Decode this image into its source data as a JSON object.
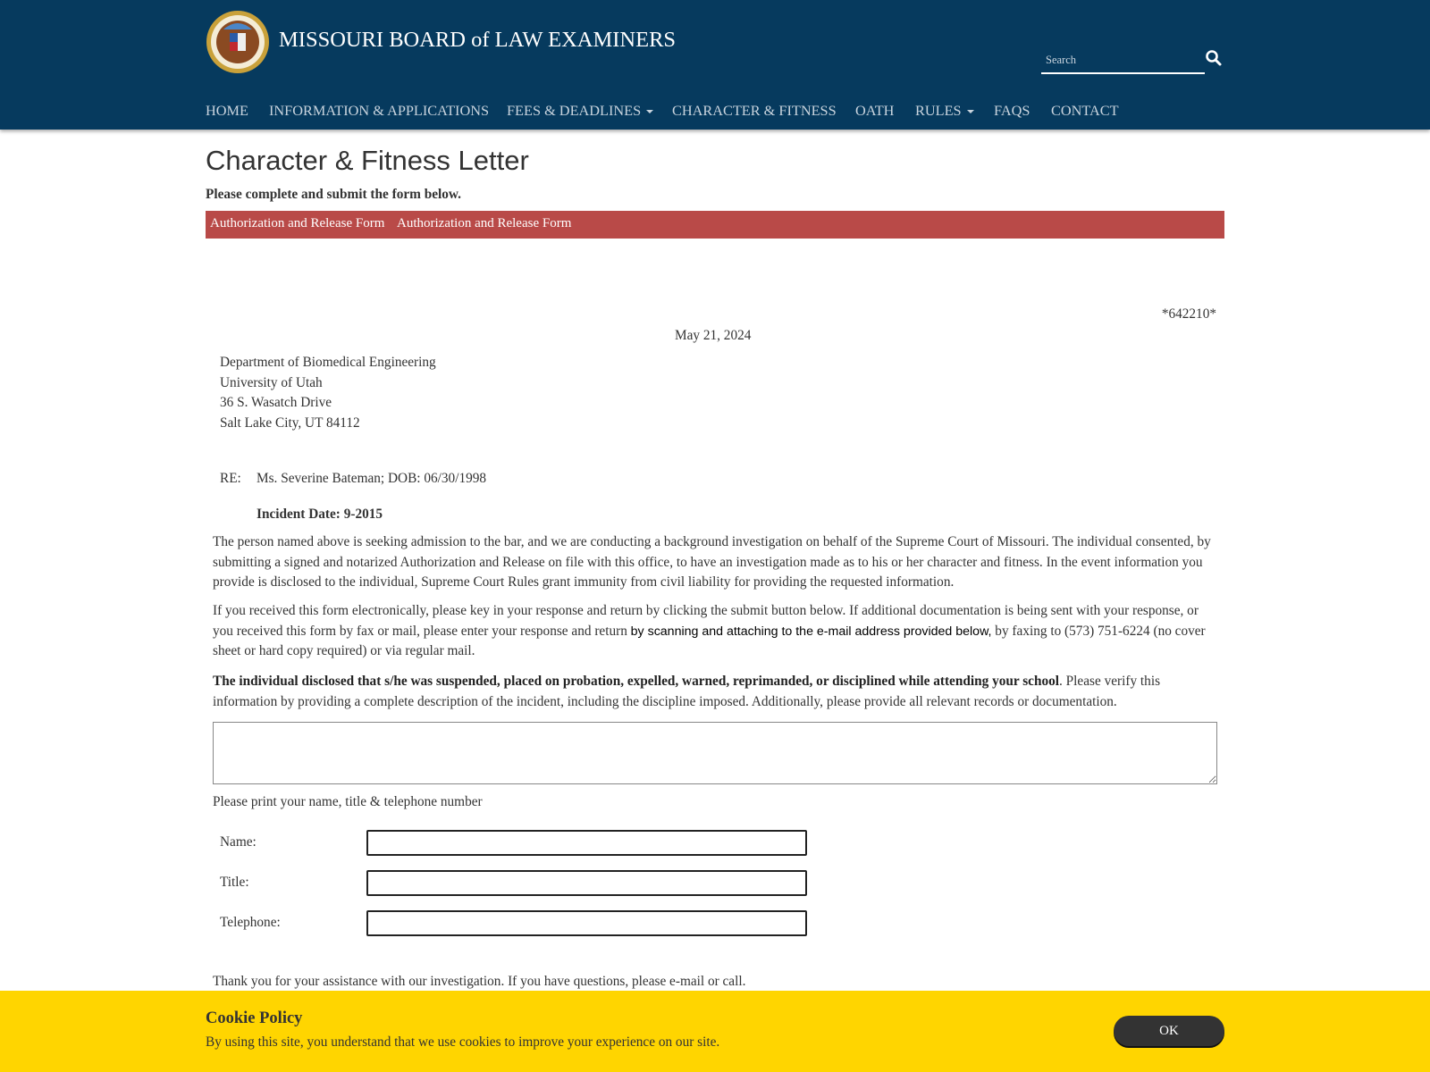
{
  "header": {
    "title": "MISSOURI BOARD of LAW EXAMINERS",
    "search_placeholder": "Search",
    "nav": [
      {
        "label": "HOME"
      },
      {
        "label": "INFORMATION & APPLICATIONS"
      },
      {
        "label": "FEES & DEADLINES",
        "dropdown": true
      },
      {
        "label": "CHARACTER & FITNESS"
      },
      {
        "label": "OATH"
      },
      {
        "label": "RULES",
        "dropdown": true
      },
      {
        "label": "FAQS"
      },
      {
        "label": "CONTACT"
      }
    ]
  },
  "page": {
    "title": "Character & Fitness Letter",
    "subtitle": "Please complete and submit the form below.",
    "tabs": [
      "Authorization and Release Form",
      "Authorization and Release Form"
    ],
    "tab_bar_color": "#b94a48"
  },
  "letter": {
    "code": "*642210*",
    "date": "May 21, 2024",
    "address": [
      "Department of Biomedical Engineering",
      "University of Utah",
      "36 S. Wasatch Drive",
      "Salt Lake City, UT 84112"
    ],
    "re_label": "RE:",
    "re_value": "Ms. Severine Bateman; DOB: 06/30/1998",
    "incident": "Incident Date: 9-2015",
    "para1": "The person named above is seeking admission to the bar, and we are conducting a background investigation on behalf of the Supreme Court of Missouri. The individual consented, by submitting a signed and notarized Authorization and Release on file with this office, to have an investigation made as to his or her character and fitness. In the event information you provide is disclosed to the individual, Supreme Court Rules grant immunity from civil liability for providing the requested information.",
    "para2a": "If you received this form electronically, please key in your response and return by clicking the submit button below. If additional documentation is being sent with your response, or you received this form by fax or mail, please enter your response and return ",
    "para2b": "by scanning and attaching to the e-mail address provided below,",
    "para2c": " by faxing to (573) 751-6224 (no cover sheet or hard copy required) or via regular mail.",
    "para3_bold": "The individual disclosed that s/he was suspended, placed on probation, expelled, warned, reprimanded, or disciplined while attending your school",
    "para3_rest": ". Please verify this information by providing a complete description of the incident, including the discipline imposed. Additionally, please provide all relevant records or documentation.",
    "response_value": "",
    "print_prompt": "Please print your name, title & telephone number",
    "fields": [
      {
        "label": "Name:",
        "value": ""
      },
      {
        "label": "Title:",
        "value": ""
      },
      {
        "label": "Telephone:",
        "value": ""
      }
    ],
    "thanks": "Thank you for your assistance with our investigation. If you have questions, please e-mail or call."
  },
  "cookie": {
    "title": "Cookie Policy",
    "text": "By using this site, you understand that we use cookies to improve your experience on our site.",
    "ok": "OK",
    "bg_color": "#ffd500"
  }
}
